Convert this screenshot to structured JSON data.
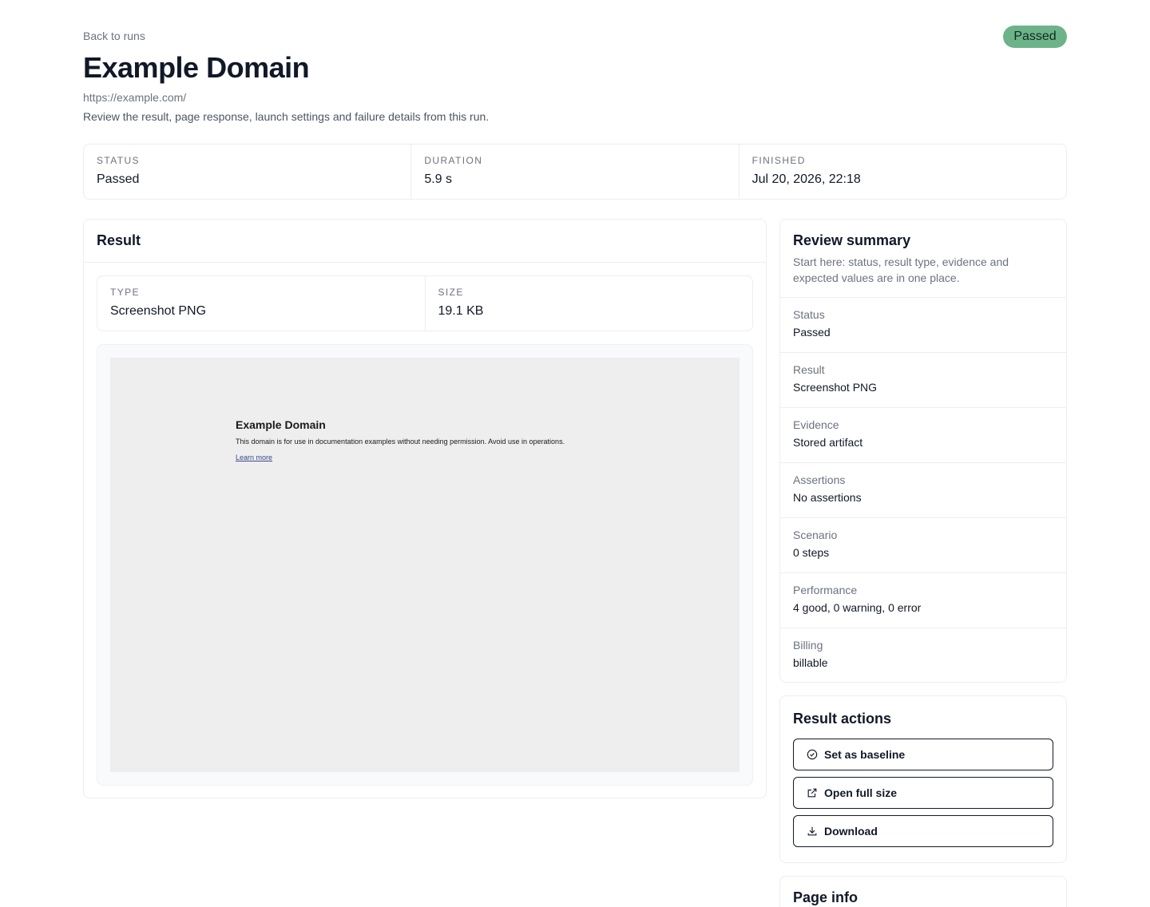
{
  "nav": {
    "back_label": "Back to runs"
  },
  "header": {
    "status_badge": "Passed",
    "title": "Example Domain",
    "url": "https://example.com/",
    "description": "Review the result, page response, launch settings and failure details from this run."
  },
  "stats": [
    {
      "label": "STATUS",
      "value": "Passed"
    },
    {
      "label": "DURATION",
      "value": "5.9 s"
    },
    {
      "label": "FINISHED",
      "value": "Jul 20, 2026, 22:18"
    }
  ],
  "result": {
    "title": "Result",
    "meta": [
      {
        "label": "TYPE",
        "value": "Screenshot PNG"
      },
      {
        "label": "SIZE",
        "value": "19.1 KB"
      }
    ],
    "preview": {
      "title": "Example Domain",
      "text": "This domain is for use in documentation examples without needing permission. Avoid use in operations.",
      "link": "Learn more"
    }
  },
  "summary": {
    "title": "Review summary",
    "subtitle": "Start here: status, result type, evidence and expected values are in one place.",
    "rows": [
      {
        "label": "Status",
        "value": "Passed"
      },
      {
        "label": "Result",
        "value": "Screenshot PNG"
      },
      {
        "label": "Evidence",
        "value": "Stored artifact"
      },
      {
        "label": "Assertions",
        "value": "No assertions"
      },
      {
        "label": "Scenario",
        "value": "0 steps"
      },
      {
        "label": "Performance",
        "value": "4 good, 0 warning, 0 error"
      },
      {
        "label": "Billing",
        "value": "billable"
      }
    ]
  },
  "actions": {
    "title": "Result actions",
    "buttons": [
      {
        "label": "Set as baseline",
        "icon": "check-circle-icon"
      },
      {
        "label": "Open full size",
        "icon": "external-link-icon"
      },
      {
        "label": "Download",
        "icon": "download-icon"
      }
    ]
  },
  "page_info": {
    "title": "Page info"
  },
  "colors": {
    "passed_badge": "#6cb38a",
    "border": "#eceef1",
    "muted_text": "#6b7280"
  }
}
